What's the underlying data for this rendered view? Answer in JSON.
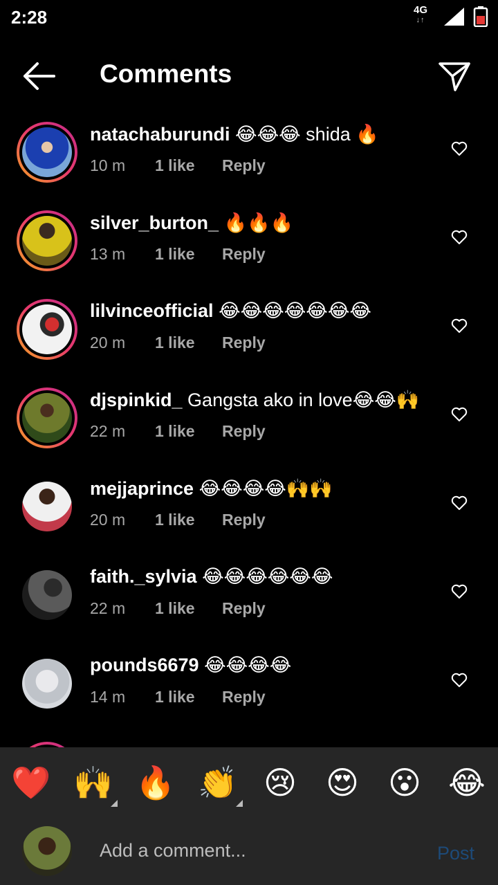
{
  "status": {
    "time": "2:28",
    "network": "4G"
  },
  "header": {
    "title": "Comments"
  },
  "comments": [
    {
      "user": "natachaburundi",
      "text": "😂😂😂 shida 🔥",
      "time": "10 m",
      "likes": "1 like",
      "reply": "Reply"
    },
    {
      "user": "silver_burton_",
      "text": "🔥🔥🔥",
      "time": "13 m",
      "likes": "1 like",
      "reply": "Reply"
    },
    {
      "user": "lilvinceofficial",
      "text": "😂😂😂😂😂😂😂",
      "time": "20 m",
      "likes": "1 like",
      "reply": "Reply"
    },
    {
      "user": "djspinkid_",
      "text": "Gangsta ako in love😂😂🙌",
      "time": "22 m",
      "likes": "1 like",
      "reply": "Reply"
    },
    {
      "user": "mejjaprince",
      "text": "😂😂😂😂🙌🙌",
      "time": "20 m",
      "likes": "1 like",
      "reply": "Reply"
    },
    {
      "user": "faith._sylvia",
      "text": "😂😂😂😂😂😂",
      "time": "22 m",
      "likes": "1 like",
      "reply": "Reply"
    },
    {
      "user": "pounds6679",
      "text": "😂😂😂😂",
      "time": "14 m",
      "likes": "1 like",
      "reply": "Reply"
    }
  ],
  "reactions": [
    "❤️",
    "🙌",
    "🔥",
    "👏",
    "😢",
    "😍",
    "😮",
    "😂"
  ],
  "composer": {
    "placeholder": "Add a comment...",
    "post_label": "Post"
  },
  "colors": {
    "background": "#000000",
    "panel": "#262626",
    "post_disabled": "#1d4a78",
    "ring_start": "#f6a821",
    "ring_end": "#c42b8a"
  },
  "icons": {
    "back": "arrow-left-icon",
    "send": "paper-plane-icon",
    "like": "heart-outline-icon",
    "signal": "signal-icon",
    "battery": "battery-icon"
  }
}
